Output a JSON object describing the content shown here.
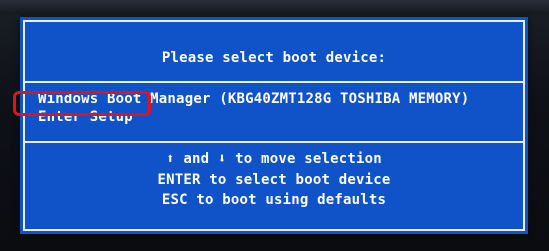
{
  "dialog": {
    "title": "Please select boot device:",
    "devices": [
      "Windows Boot Manager (KBG40ZMT128G TOSHIBA MEMORY)",
      "Enter Setup"
    ],
    "selected_index": 1,
    "help": {
      "up_arrow": "⬆",
      "line1_and": " and ",
      "down_arrow": "⬇",
      "line1_rest": " to move selection",
      "line2": "ENTER to select boot device",
      "line3": "ESC to boot using defaults"
    }
  },
  "colors": {
    "panel": "#1053c8",
    "text": "#ffffff",
    "highlight_ring": "#e0131b"
  }
}
